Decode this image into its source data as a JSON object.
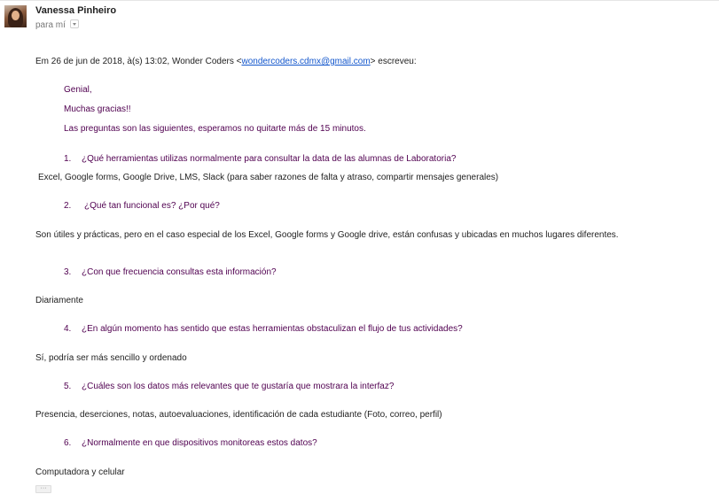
{
  "sender": {
    "name": "Vanessa Pinheiro",
    "to_label": "para mí"
  },
  "quote_header": {
    "prefix": "Em 26 de jun de 2018, à(s) 13:02, Wonder Coders <",
    "email": "wondercoders.cdmx@gmail.com",
    "suffix": "> escreveu:"
  },
  "body": {
    "greeting": "Genial,",
    "thanks": "Muchas gracias!!",
    "intro": "Las preguntas son las siguientes, esperamos no quitarte más de 15 minutos."
  },
  "qa": [
    {
      "number": "1.",
      "question": "¿Qué herramientas utilizas normalmente para consultar la data de las alumnas de Laboratoria?",
      "answer": "Excel, Google forms, Google Drive, LMS, Slack (para saber razones de falta y atraso, compartir mensajes generales)"
    },
    {
      "number": "2.",
      "question": "¿Qué tan funcional es? ¿Por qué?",
      "answer": "Son útiles y prácticas, pero en el caso especial de los Excel, Google forms y Google drive, están confusas y ubicadas en muchos lugares diferentes."
    },
    {
      "number": "3.",
      "question": "¿Con que frecuencia consultas esta información?",
      "answer": "Diariamente"
    },
    {
      "number": "4.",
      "question": "¿En algún momento has sentido que estas herramientas obstaculizan el flujo de tus actividades?",
      "answer": "Sí, podría ser más sencillo y ordenado"
    },
    {
      "number": "5.",
      "question": "¿Cuáles son los datos más relevantes que te gustaría que mostrara la interfaz?",
      "answer": "Presencia, deserciones, notas, autoevaluaciones, identificación de cada estudiante (Foto, correo, perfil)"
    },
    {
      "number": "6.",
      "question": "¿Normalmente en que dispositivos monitoreas estos datos?",
      "answer": "Computadora y celular"
    }
  ],
  "show_trimmed": "···"
}
